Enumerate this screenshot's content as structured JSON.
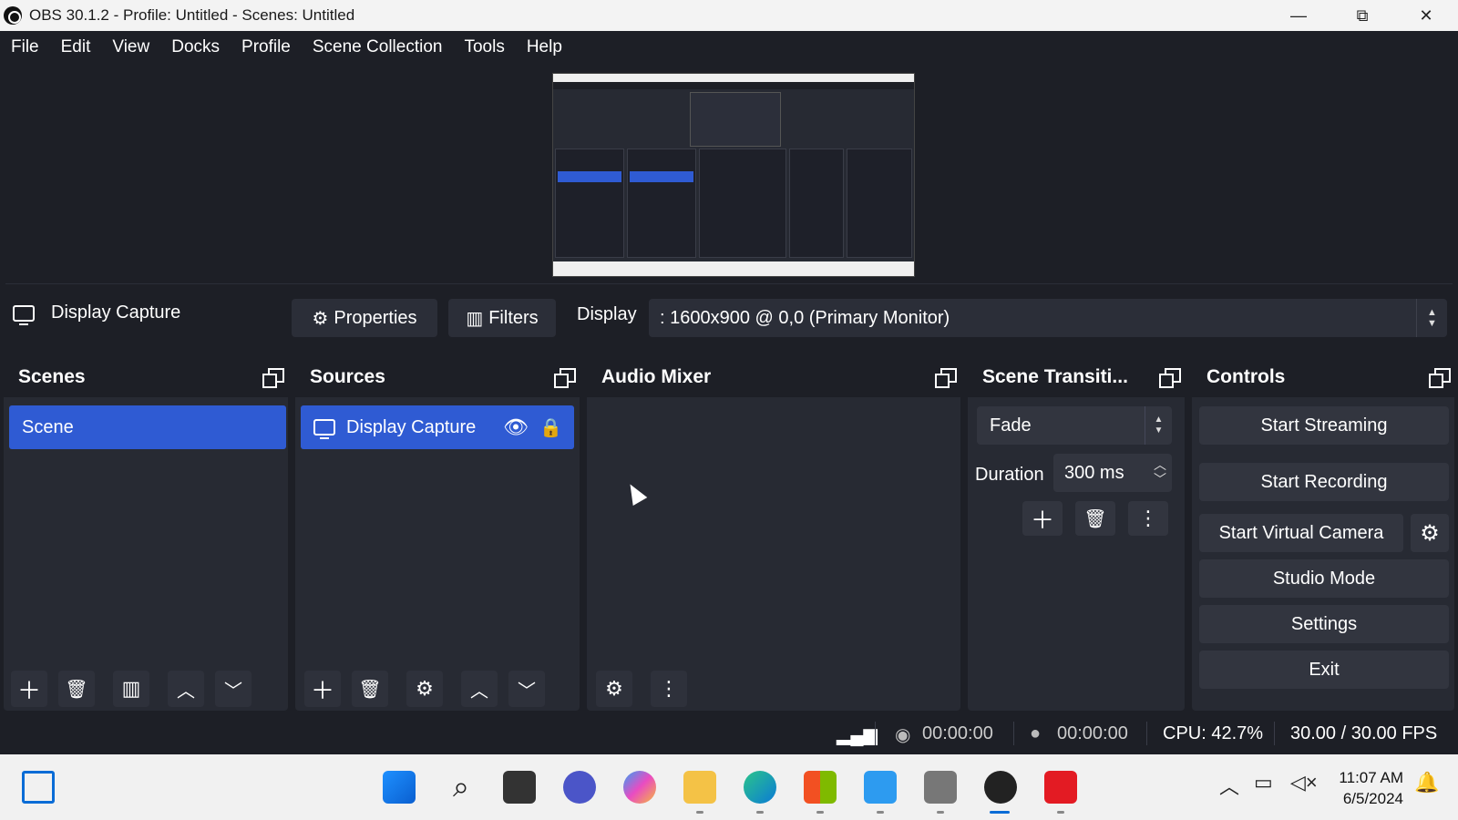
{
  "window": {
    "title": "OBS 30.1.2 - Profile: Untitled - Scenes: Untitled",
    "minimize": "—",
    "maximize": "⧉",
    "close": "✕"
  },
  "menu": [
    "File",
    "Edit",
    "View",
    "Docks",
    "Profile",
    "Scene Collection",
    "Tools",
    "Help"
  ],
  "source_toolbar": {
    "source_name": "Display Capture",
    "properties_label": "Properties",
    "filters_label": "Filters",
    "display_label": "Display",
    "display_value": ": 1600x900 @ 0,0 (Primary Monitor)"
  },
  "scenes": {
    "title": "Scenes",
    "items": [
      "Scene"
    ],
    "footer_icons": [
      "add-icon",
      "trash-icon",
      "filter-icon",
      "up-icon",
      "down-icon"
    ]
  },
  "sources": {
    "title": "Sources",
    "items": [
      {
        "label": "Display Capture",
        "visible": true,
        "locked": true
      }
    ],
    "footer_icons": [
      "add-icon",
      "trash-icon",
      "gear-icon",
      "up-icon",
      "down-icon"
    ]
  },
  "audio_mixer": {
    "title": "Audio Mixer",
    "footer_icons": [
      "advanced-audio-icon",
      "kebab-icon"
    ]
  },
  "transitions": {
    "title": "Scene Transiti...",
    "selected": "Fade",
    "duration_label": "Duration",
    "duration_value": "300 ms"
  },
  "controls": {
    "title": "Controls",
    "start_streaming": "Start Streaming",
    "start_recording": "Start Recording",
    "start_virtual_camera": "Start Virtual Camera",
    "studio_mode": "Studio Mode",
    "settings": "Settings",
    "exit": "Exit"
  },
  "status": {
    "stream_time": "00:00:00",
    "record_time": "00:00:00",
    "cpu": "CPU: 42.7%",
    "fps": "30.00 / 30.00 FPS"
  },
  "taskbar": {
    "time": "11:07 AM",
    "date": "6/5/2024"
  },
  "colors": {
    "background": "#1d1f26",
    "panel": "#272a33",
    "selection": "#2f5bd3",
    "button": "#32353f"
  }
}
